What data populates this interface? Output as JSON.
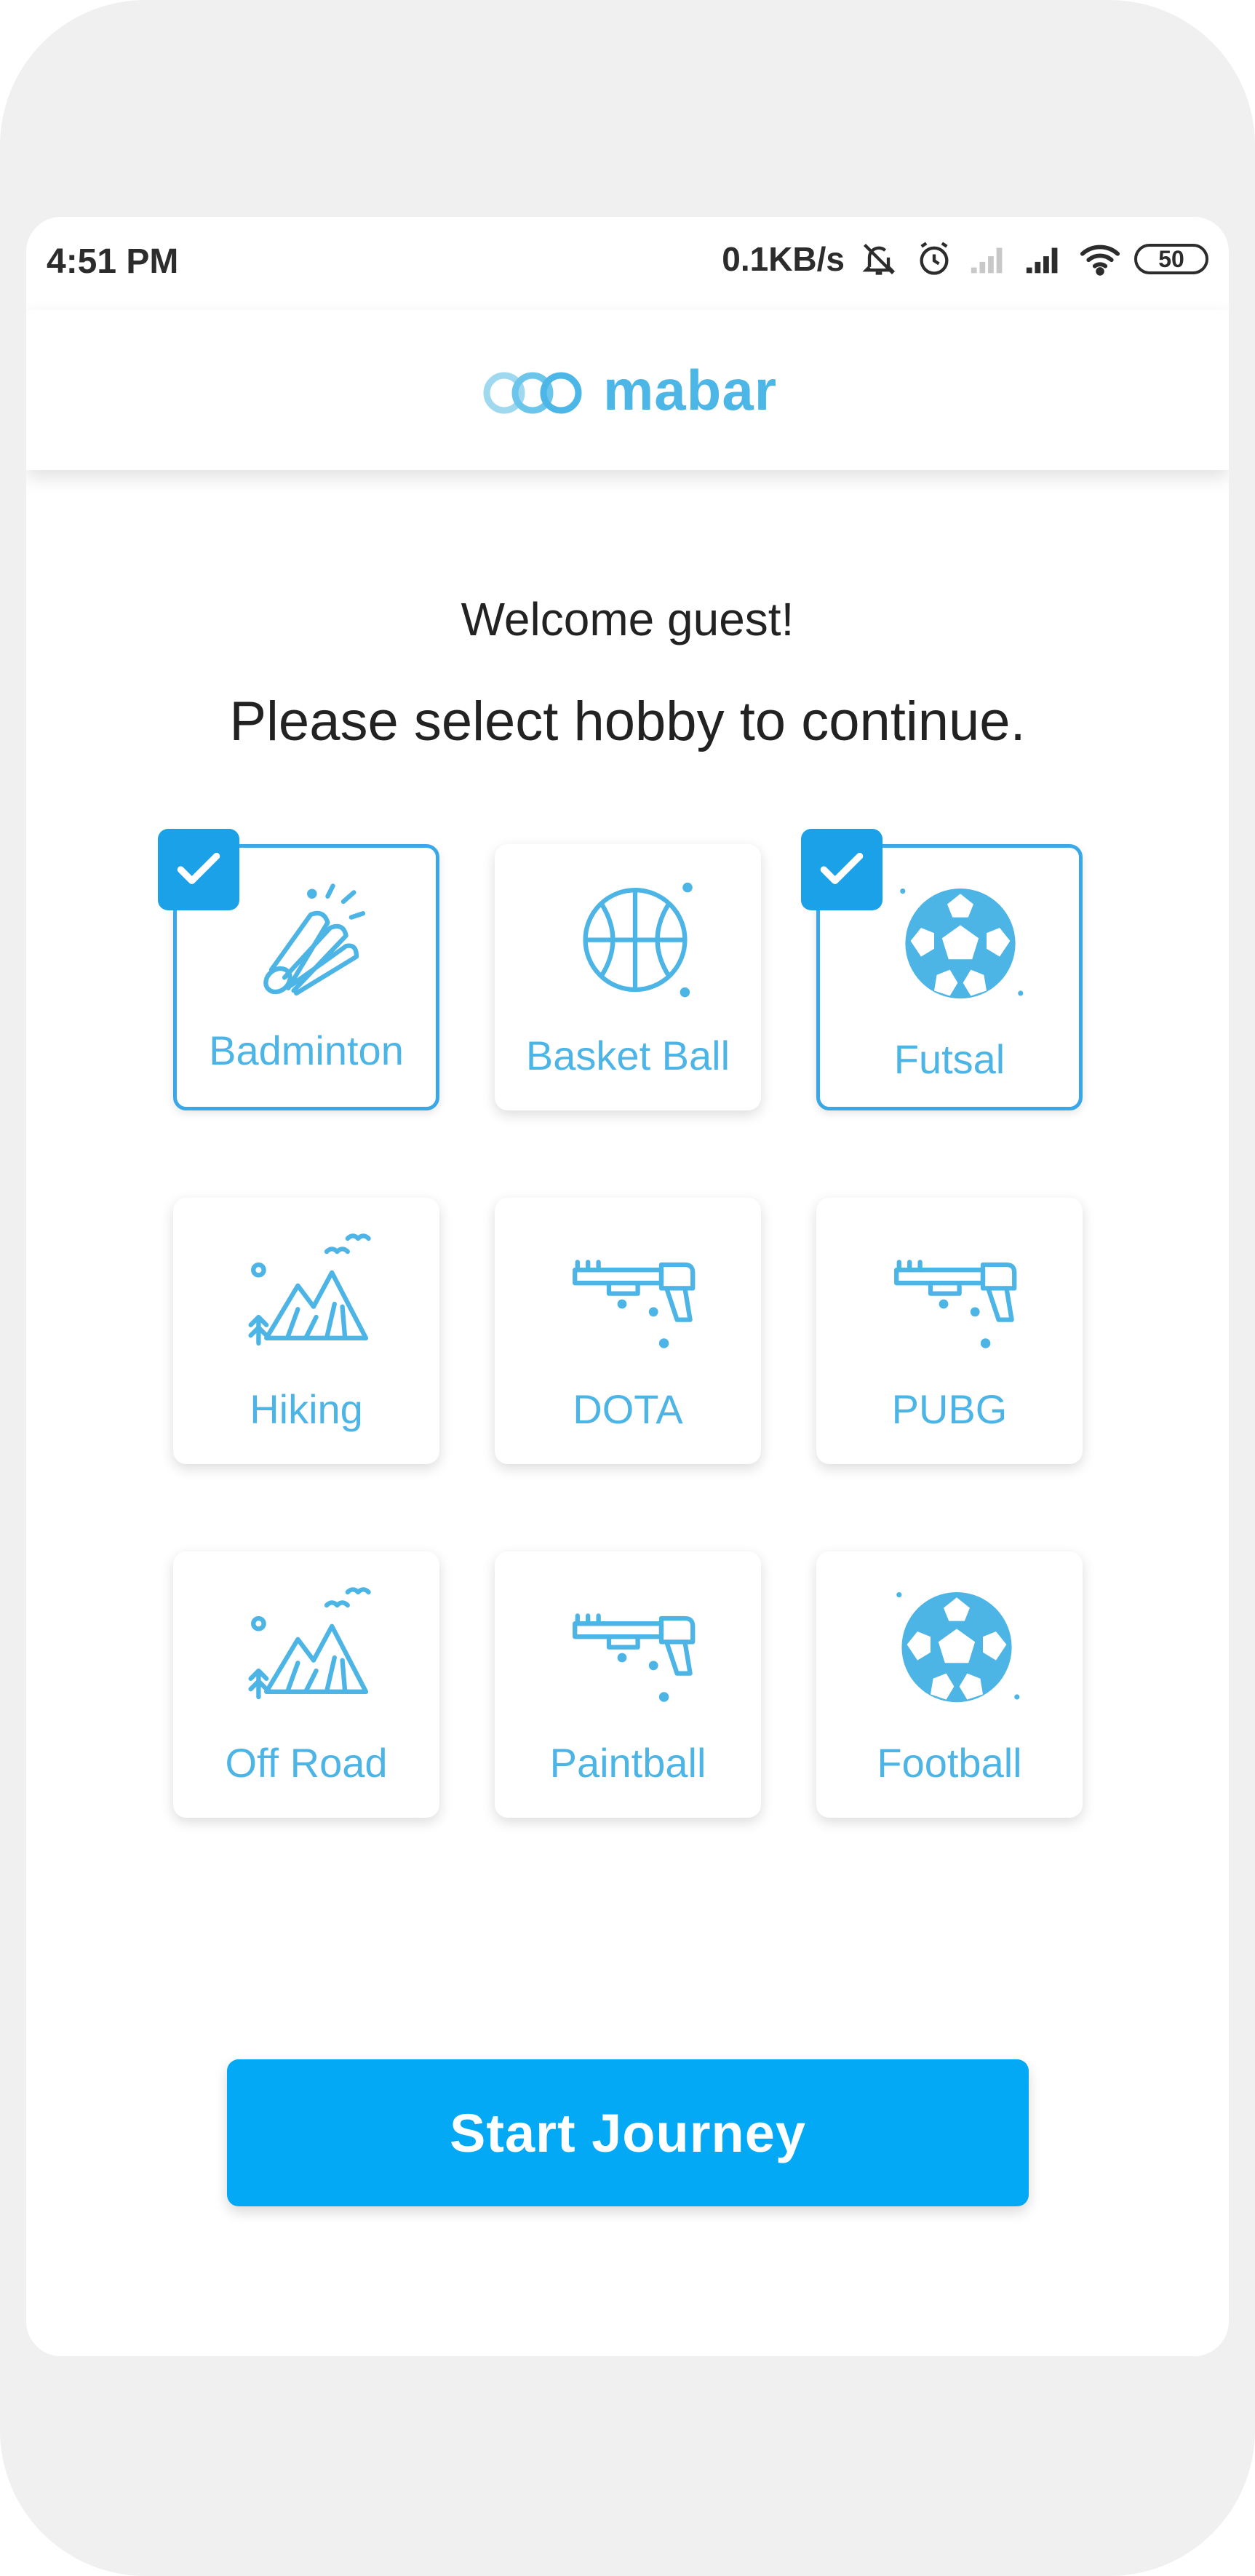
{
  "status": {
    "time": "4:51 PM",
    "speed": "0.1KB/s",
    "battery": "50",
    "icons": [
      "bell-off-icon",
      "alarm-icon",
      "signal-weak-icon",
      "signal-icon",
      "wifi-icon",
      "battery-icon"
    ]
  },
  "app": {
    "logo_text": "mabar",
    "brand_color": "#4cb6e6",
    "accent_color": "#03a9f4"
  },
  "greeting": {
    "welcome": "Welcome guest!",
    "instruction": "Please select hobby to continue."
  },
  "hobbies": [
    {
      "label": "Badminton",
      "icon": "shuttlecock-icon",
      "selected": true
    },
    {
      "label": "Basket Ball",
      "icon": "basketball-icon",
      "selected": false
    },
    {
      "label": "Futsal",
      "icon": "soccer-ball-icon",
      "selected": true
    },
    {
      "label": "Hiking",
      "icon": "mountain-icon",
      "selected": false
    },
    {
      "label": "DOTA",
      "icon": "gun-icon",
      "selected": false
    },
    {
      "label": "PUBG",
      "icon": "gun-icon",
      "selected": false
    },
    {
      "label": "Off Road",
      "icon": "mountain-icon",
      "selected": false
    },
    {
      "label": "Paintball",
      "icon": "gun-icon",
      "selected": false
    },
    {
      "label": "Football",
      "icon": "soccer-ball-icon",
      "selected": false
    }
  ],
  "actions": {
    "start_label": "Start Journey"
  }
}
